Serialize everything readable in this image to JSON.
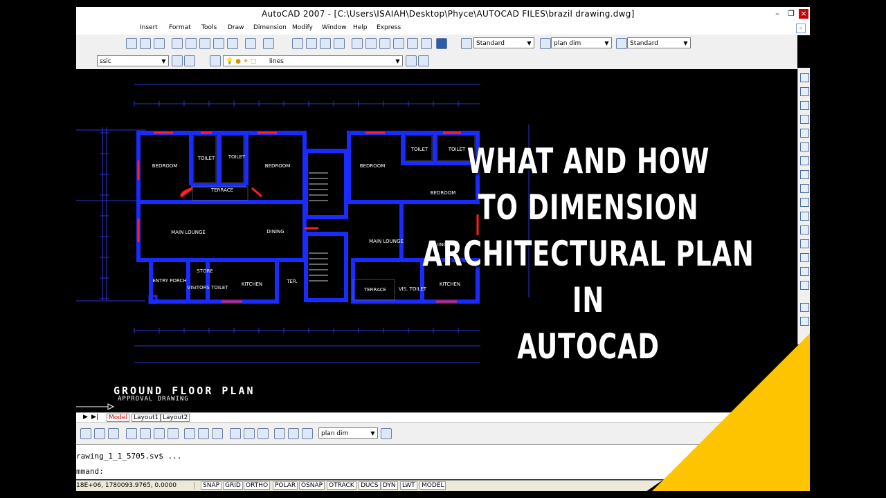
{
  "window": {
    "title": "AutoCAD 2007 - [C:\\Users\\ISAIAH\\Desktop\\Phyce\\AUTOCAD FILES\\brazil drawing.dwg]"
  },
  "menu": [
    "Insert",
    "Format",
    "Tools",
    "Draw",
    "Dimension",
    "Modify",
    "Window",
    "Help",
    "Express"
  ],
  "toolbar": {
    "text_style": "Standard",
    "dim_style": "plan dim",
    "table_style": "Standard",
    "workspace": "ssic",
    "layer": "lines",
    "dim_style_bottom": "plan dim"
  },
  "tabs": [
    "Model",
    "Layout1",
    "Layout2"
  ],
  "command": {
    "line1": "rawing_1_1_5705.sv$ ...",
    "line2": "mmand:"
  },
  "status": {
    "coords": "18E+06, 1780093.9765, 0.0000",
    "buttons": [
      "SNAP",
      "GRID",
      "ORTHO",
      "POLAR",
      "OSNAP",
      "OTRACK",
      "DUCS",
      "DYN",
      "LWT",
      "MODEL"
    ]
  },
  "plan": {
    "title": "GROUND  FLOOR PLAN",
    "subtitle": "APPROVAL DRAWING",
    "rooms": [
      "BEDROOM",
      "TOILET",
      "TOILET",
      "BEDROOM",
      "TERRACE",
      "MAIN LOUNGE",
      "DINING",
      "ENTRY PORCH",
      "STORE",
      "VISITORS TOILET",
      "KITCHEN",
      "TER.",
      "BEDROOM",
      "TOILET",
      "TOILET",
      "BEDROOM",
      "MAIN LOUNGE",
      "DINING TER.",
      "TERRACE",
      "VIS. TOILET",
      "KITCHEN"
    ]
  },
  "headline": [
    "WHAT AND HOW",
    "TO DIMENSION",
    "ARCHITECTURAL PLAN IN",
    "AUTOCAD"
  ],
  "colors": {
    "accent_orange": "#ff5a0a",
    "accent_yellow": "#ffc400",
    "wall": "#1a2bff",
    "door": "#ff2020"
  }
}
